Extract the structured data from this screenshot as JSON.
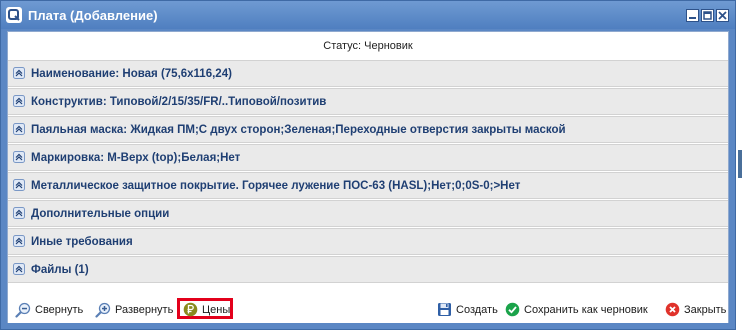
{
  "window": {
    "title": "Плата (Добавление)"
  },
  "status": {
    "text": "Статус: Черновик"
  },
  "sections": [
    {
      "label": "Наименование: Новая (75,6x116,24)"
    },
    {
      "label": "Конструктив: Типовой/2/15/35/FR/..Типовой/позитив"
    },
    {
      "label": "Паяльная маска: Жидкая ПМ;С двух сторон;Зеленая;Переходные отверстия закрыты маской"
    },
    {
      "label": "Маркировка: М-Верх (top);Белая;Нет"
    },
    {
      "label": "Металлическое защитное покрытие. Горячее лужение ПОС-63 (HASL);Нет;0;0S-0;>Нет"
    },
    {
      "label": "Дополнительные опции"
    },
    {
      "label": "Иные требования"
    },
    {
      "label": "Файлы (1)"
    }
  ],
  "toolbar": {
    "collapse_label": "Свернуть",
    "expand_label": "Развернуть",
    "prices_label": "Цены",
    "create_label": "Создать",
    "save_draft_label": "Сохранить как черновик",
    "close_label": "Закрыть"
  },
  "colors": {
    "title_bar": "#5b87c4",
    "section_text": "#1f3f73",
    "highlight_border": "#e3001b",
    "save_icon": "#1aa34a",
    "close_icon": "#e0322b",
    "prices_icon": "#8a8a1e"
  },
  "icons": {
    "app": "app-icon",
    "section_toggle": "expand-toggle-icon",
    "collapse": "zoom-out-icon",
    "expand": "zoom-in-icon",
    "prices": "ruble-icon",
    "create": "floppy-disk-icon",
    "save_draft": "check-circle-icon",
    "close": "close-circle-icon"
  }
}
